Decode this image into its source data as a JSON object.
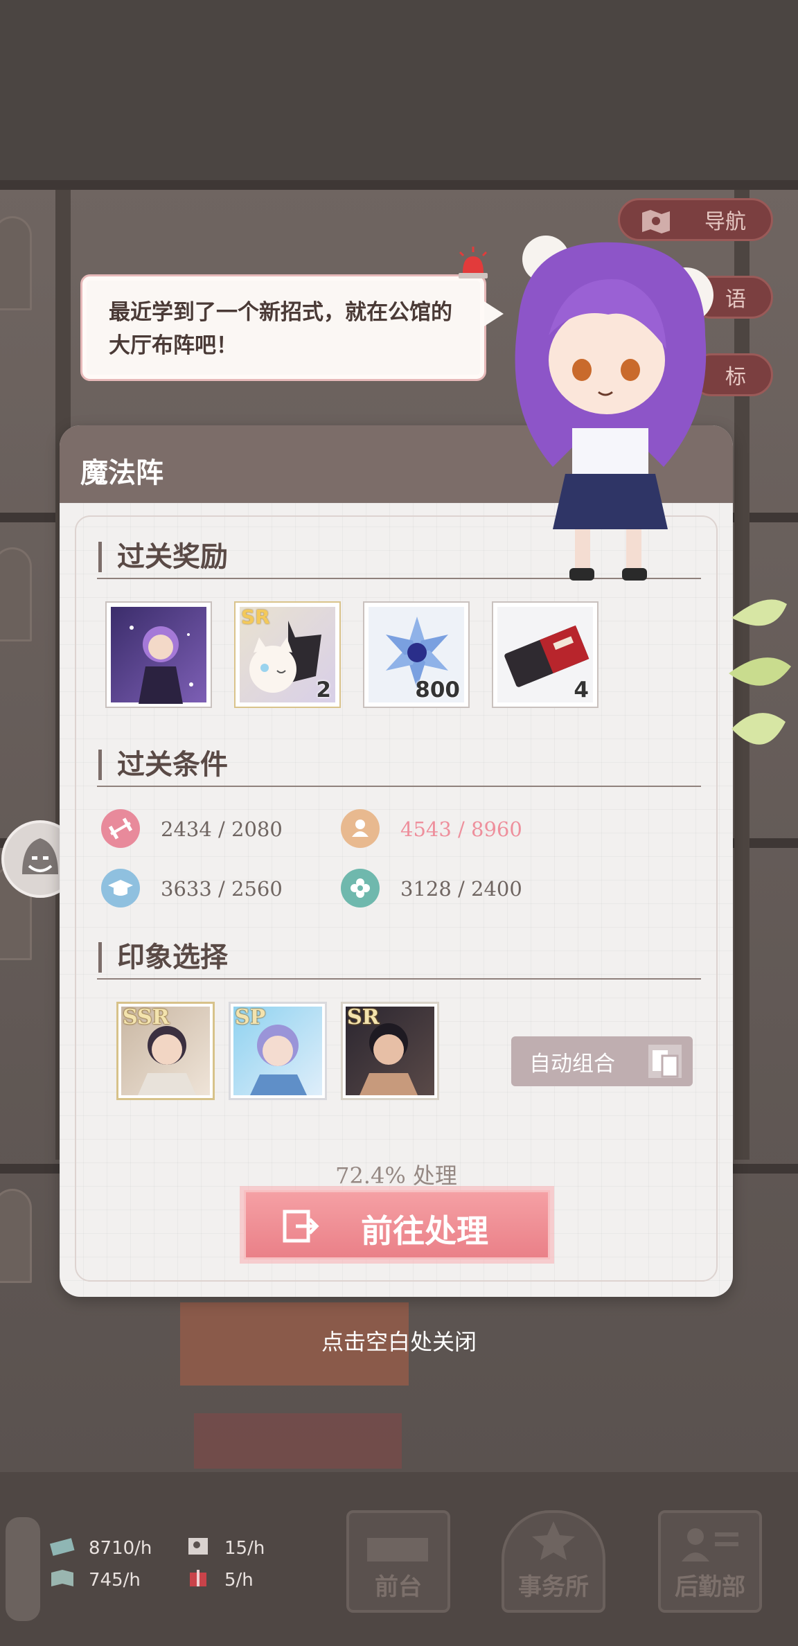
{
  "side_buttons": [
    "导航",
    "语",
    "标"
  ],
  "dialog": {
    "text": "最近学到了一个新招式，就在公馆的大厅布阵吧！"
  },
  "panel": {
    "title": "魔法阵",
    "rewards_title": "过关奖励",
    "rewards": [
      {
        "icon": "character-card-icon",
        "count": ""
      },
      {
        "icon": "cat-card-icon",
        "badge": "SR",
        "count": "2"
      },
      {
        "icon": "crystal-icon",
        "count": "800"
      },
      {
        "icon": "ticket-icon",
        "count": "4"
      }
    ],
    "conditions_title": "过关条件",
    "conditions": [
      {
        "icon": "barbell-icon",
        "color": "#e88a9b",
        "current": "2434",
        "required": "/ 2080",
        "met": true
      },
      {
        "icon": "person-icon",
        "color": "#e8b98f",
        "current": "4543",
        "required": "/ 8960",
        "met": false
      },
      {
        "icon": "graduation-cap-icon",
        "color": "#8fc0df",
        "current": "3633",
        "required": "/ 2560",
        "met": true
      },
      {
        "icon": "flower-icon",
        "color": "#6fb8ad",
        "current": "3128",
        "required": "/ 2400",
        "met": true
      }
    ],
    "impression_title": "印象选择",
    "cards": [
      {
        "rarity": "SSR"
      },
      {
        "rarity": "SP"
      },
      {
        "rarity": "SR"
      }
    ],
    "auto_button": "自动组合",
    "progress_text": "72.4% 处理",
    "go_button": "前往处理"
  },
  "close_hint": "点击空白处关闭",
  "bottom_bar": {
    "stats": [
      {
        "icon": "cash-icon",
        "value": "8710/h"
      },
      {
        "icon": "picture-icon",
        "value": "15/h"
      },
      {
        "icon": "book-icon",
        "value": "745/h"
      },
      {
        "icon": "gift-icon",
        "value": "5/h"
      }
    ],
    "nav": [
      "前台",
      "事务所",
      "后勤部"
    ]
  }
}
